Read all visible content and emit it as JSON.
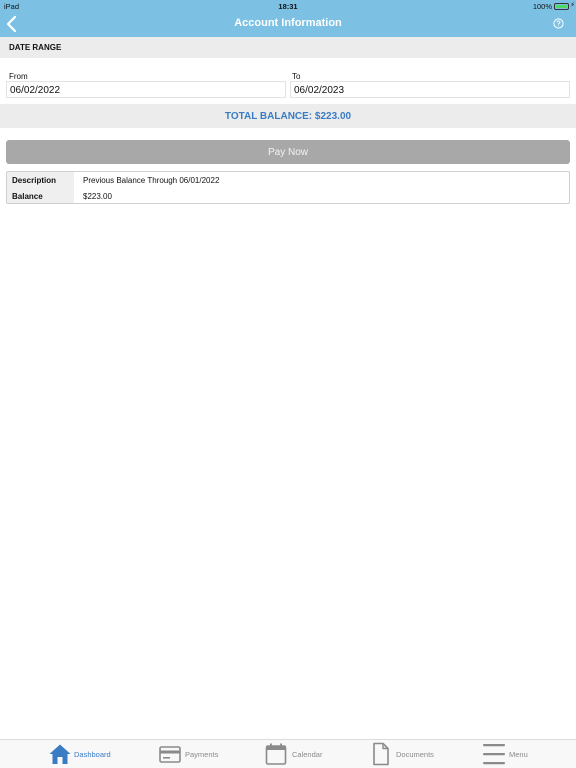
{
  "status_bar": {
    "carrier": "iPad",
    "time": "18:31",
    "battery": "100%",
    "battery_level": 1.0
  },
  "nav": {
    "title": "Account Information",
    "back_icon": "chevron-left-icon",
    "help_icon": "question-circle-icon"
  },
  "date_range": {
    "section_label": "DATE RANGE",
    "from_label": "From",
    "from_value": "06/02/2022",
    "to_label": "To",
    "to_value": "06/02/2023"
  },
  "total_balance": "TOTAL BALANCE: $223.00",
  "pay_button": "Pay Now",
  "details": [
    {
      "key": "Description",
      "value": "Previous Balance Through 06/01/2022"
    },
    {
      "key": "Balance",
      "value": "$223.00"
    }
  ],
  "tabs": [
    {
      "label": "Dashboard",
      "icon": "house-icon",
      "active": true
    },
    {
      "label": "Payments",
      "icon": "credit-card-icon",
      "active": false
    },
    {
      "label": "Calendar",
      "icon": "calendar-icon",
      "active": false
    },
    {
      "label": "Documents",
      "icon": "document-icon",
      "active": false
    },
    {
      "label": "Menu",
      "icon": "hamburger-menu-icon",
      "active": false
    }
  ],
  "colors": {
    "header": "#7cc0e4",
    "accent": "#3a7cc4",
    "pay_button": "#a8a8a8",
    "band": "#ececec"
  }
}
